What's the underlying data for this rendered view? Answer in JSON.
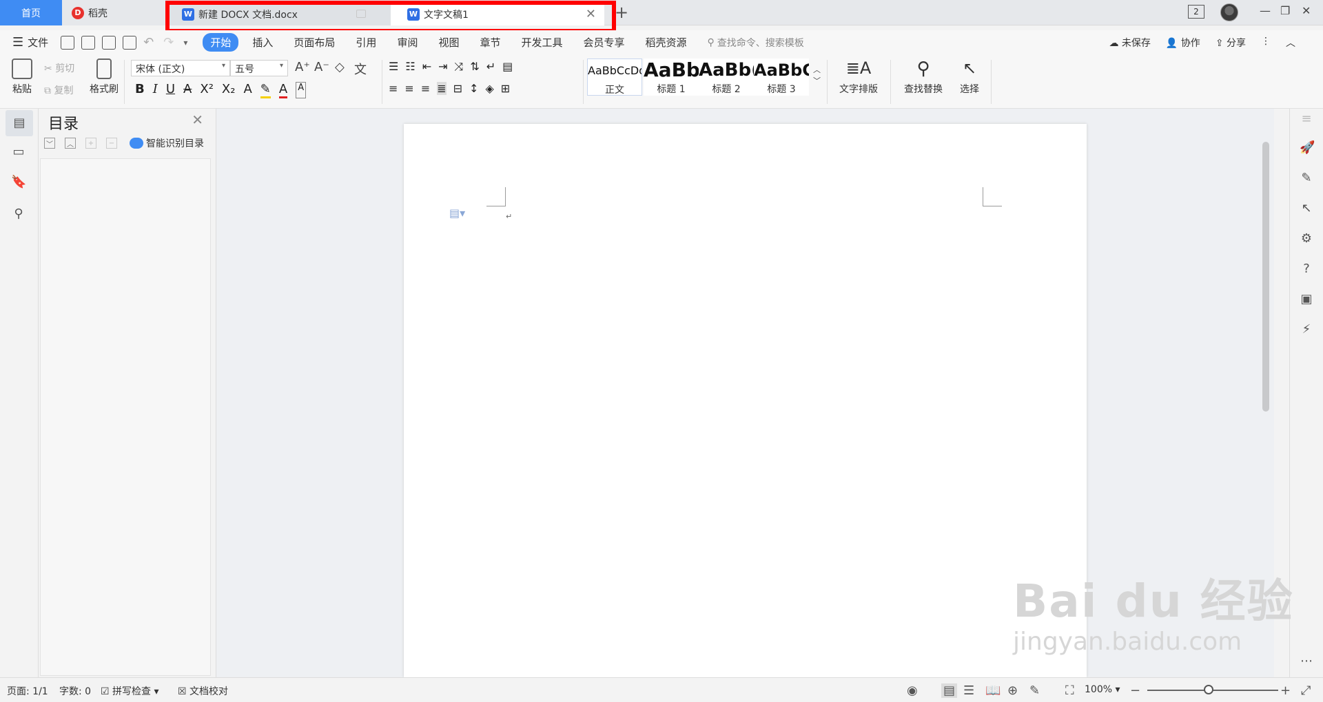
{
  "titlebar": {
    "home_tab": "首页",
    "daoke_tab": "稻壳",
    "daoke_logo": "D",
    "doc_tabs": [
      {
        "label": "新建 DOCX 文档.docx",
        "icon": "W"
      },
      {
        "label": "文字文稿1",
        "icon": "W"
      }
    ],
    "new_tab": "+",
    "window_badge": "2",
    "minimize": "—",
    "restore": "❐",
    "close": "✕"
  },
  "menubar": {
    "file": "文件",
    "tabs": [
      "开始",
      "插入",
      "页面布局",
      "引用",
      "审阅",
      "视图",
      "章节",
      "开发工具",
      "会员专享",
      "稻壳资源"
    ],
    "search_placeholder": "查找命令、搜索模板",
    "unsaved": "未保存",
    "collab": "协作",
    "share": "分享"
  },
  "ribbon": {
    "paste": "粘贴",
    "cut": "剪切",
    "copy": "复制",
    "format_painter": "格式刷",
    "font_name": "宋体 (正文)",
    "font_size": "五号",
    "styles": [
      {
        "preview": "AaBbCcDd",
        "label": "正文"
      },
      {
        "preview": "AaBb",
        "label": "标题 1"
      },
      {
        "preview": "AaBb(",
        "label": "标题 2"
      },
      {
        "preview": "AaBbC",
        "label": "标题 3"
      }
    ],
    "text_layout": "文字排版",
    "find_replace": "查找替换",
    "select": "选择"
  },
  "toc": {
    "title": "目录",
    "smart_toc": "智能识别目录"
  },
  "statusbar": {
    "page": "页面: 1/1",
    "words": "字数: 0",
    "spell_check": "拼写检查",
    "proofread": "文档校对",
    "zoom": "100%"
  },
  "watermark": {
    "brand": "Bai du 经验",
    "url": "jingyan.baidu.com"
  },
  "colors": {
    "accent": "#3f8cf3",
    "highlight_box": "#ff0000",
    "word_icon": "#2f6fe4"
  }
}
